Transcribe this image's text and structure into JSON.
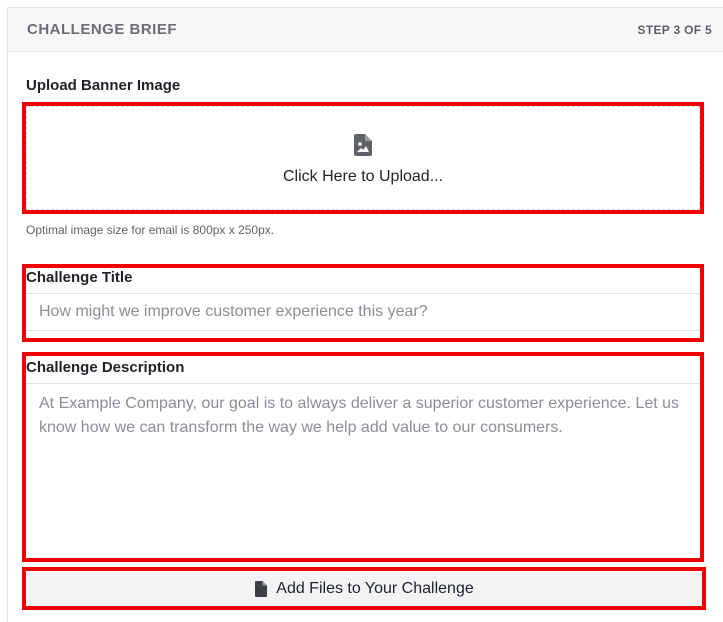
{
  "header": {
    "title": "CHALLENGE BRIEF",
    "step": "STEP 3 OF 5"
  },
  "banner": {
    "label": "Upload Banner Image",
    "upload_text": "Click Here to Upload...",
    "upload_icon": "file-image-icon",
    "hint": "Optimal image size for email is 800px x 250px."
  },
  "title_field": {
    "label": "Challenge Title",
    "placeholder": "How might we improve customer experience this year?"
  },
  "description_field": {
    "label": "Challenge Description",
    "placeholder": "At Example Company, our goal is to always deliver a superior customer experience. Let us know how we can transform the way we help add value to our consumers."
  },
  "files": {
    "label": "Add Files to Your Challenge",
    "icon": "file-icon"
  },
  "colors": {
    "highlight": "#ee0000",
    "header_bg": "#f7f7f8"
  }
}
